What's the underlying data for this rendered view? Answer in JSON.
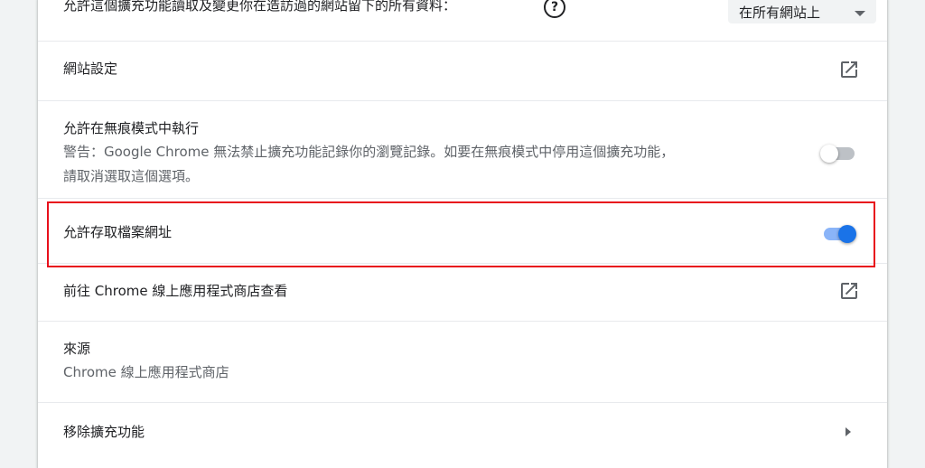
{
  "site_access": {
    "label": "允許這個擴充功能讀取及變更你在造訪過的網站留下的所有資料：",
    "help_icon": "?",
    "select_value": "在所有網站上"
  },
  "site_settings": {
    "label": "網站設定"
  },
  "incognito": {
    "label": "允許在無痕模式中執行",
    "warning_line1": "警告：Google Chrome 無法禁止擴充功能記錄你的瀏覽記錄。如要在無痕模式中停用這個擴充功能，",
    "warning_line2": "請取消選取這個選項。",
    "enabled": false
  },
  "file_urls": {
    "label": "允許存取檔案網址",
    "enabled": true
  },
  "webstore": {
    "label": "前往 Chrome 線上應用程式商店查看"
  },
  "source": {
    "label": "來源",
    "value": "Chrome 線上應用程式商店"
  },
  "remove": {
    "label": "移除擴充功能"
  },
  "colors": {
    "accent": "#1a73e8",
    "accent_track": "#8ab4f8",
    "off_track": "#bdc1c6",
    "off_knob": "#ffffff",
    "highlight": "#e8101c"
  },
  "icons": [
    "help-icon",
    "open-in-new-icon",
    "chevron-right-icon"
  ]
}
